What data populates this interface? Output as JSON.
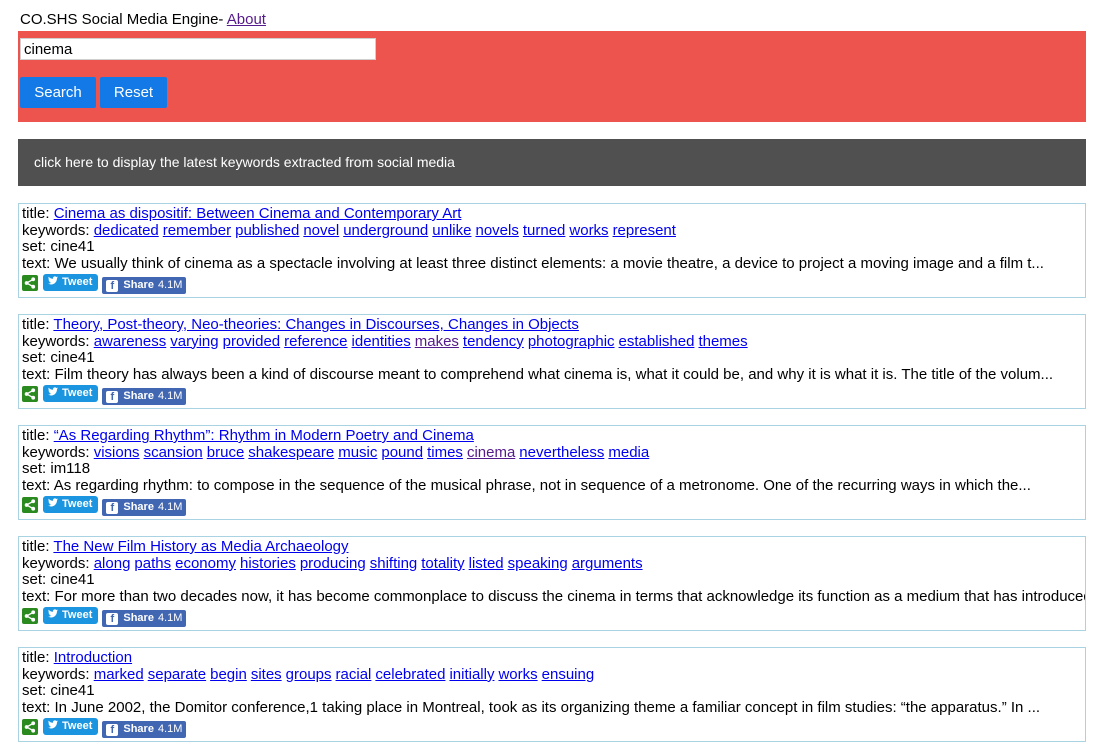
{
  "header": {
    "title": "CO.SHS Social Media Engine- ",
    "about_link": "About"
  },
  "search": {
    "value": "cinema",
    "search_label": "Search",
    "reset_label": "Reset"
  },
  "keywords_bar": {
    "label": "click here to display the latest keywords extracted from social media"
  },
  "labels": {
    "title": "title: ",
    "keywords": "keywords: ",
    "set": "set: ",
    "text": "text: "
  },
  "share": {
    "tweet": "Tweet",
    "fb_share": "Share",
    "fb_count": "4.1M"
  },
  "results": [
    {
      "title": "Cinema as dispositif: Between Cinema and Contemporary Art",
      "keywords": [
        "dedicated",
        "remember",
        "published",
        "novel",
        "underground",
        "unlike",
        "novels",
        "turned",
        "works",
        "represent"
      ],
      "visited": [],
      "set": "cine41",
      "text": "We usually think of cinema as a spectacle involving at least three distinct elements: a movie theatre, a device to project a moving image and a film t..."
    },
    {
      "title": "Theory, Post-theory, Neo-theories: Changes in Discourses, Changes in Objects",
      "keywords": [
        "awareness",
        "varying",
        "provided",
        "reference",
        "identities",
        "makes",
        "tendency",
        "photographic",
        "established",
        "themes"
      ],
      "visited": [
        5
      ],
      "set": "cine41",
      "text": "Film theory has always been a kind of discourse meant to comprehend what cinema is, what it could be, and why it is what it is. The title of the volum..."
    },
    {
      "title": "“As Regarding Rhythm”: Rhythm in Modern Poetry and Cinema",
      "keywords": [
        "visions",
        "scansion",
        "bruce",
        "shakespeare",
        "music",
        "pound",
        "times",
        "cinema",
        "nevertheless",
        "media"
      ],
      "visited": [
        7
      ],
      "set": "im118",
      "text": "As regarding rhythm: to compose in the sequence of the musical phrase, not in sequence of a metronome. One of the recurring ways in which the..."
    },
    {
      "title": "The New Film History as Media Archaeology",
      "keywords": [
        "along",
        "paths",
        "economy",
        "histories",
        "producing",
        "shifting",
        "totality",
        "listed",
        "speaking",
        "arguments"
      ],
      "visited": [],
      "set": "cine41",
      "text": "For more than two decades now, it has become commonplace to discuss the cinema in terms that acknowledge its function as a medium that has introduced ..."
    },
    {
      "title": "Introduction",
      "keywords": [
        "marked",
        "separate",
        "begin",
        "sites",
        "groups",
        "racial",
        "celebrated",
        "initially",
        "works",
        "ensuing"
      ],
      "visited": [],
      "set": "cine41",
      "text": "In June 2002, the Domitor conference,1 taking place in Montreal, took as its organizing theme a familiar concept in film studies: “the apparatus.” In ..."
    }
  ]
}
